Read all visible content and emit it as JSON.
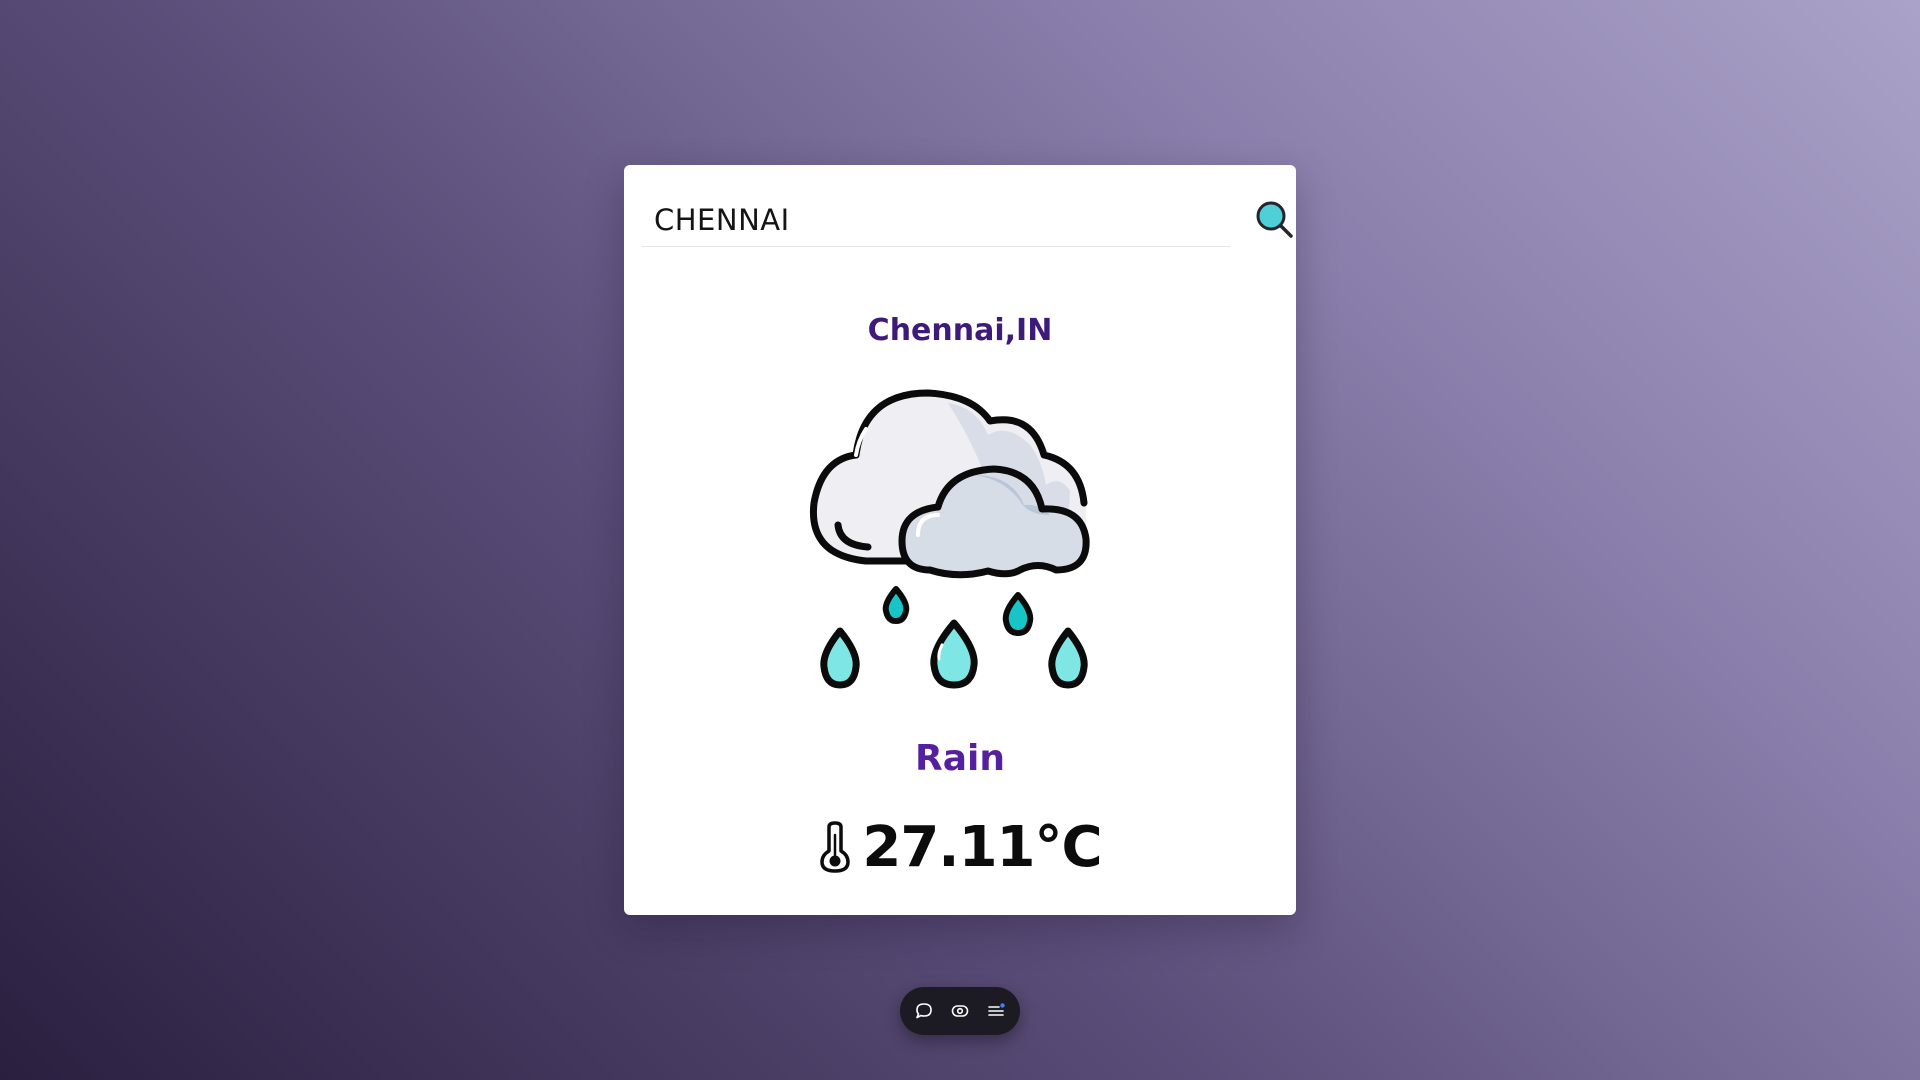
{
  "search": {
    "value": "CHENNAI",
    "placeholder": ""
  },
  "weather": {
    "location": "Chennai,IN",
    "icon": "cloud-rain-icon",
    "condition": "Rain",
    "temperature": "27.11°C"
  },
  "icons": {
    "search_button": "search-icon",
    "temperature": "thermometer-icon",
    "toolbar": [
      "comment-icon",
      "eye-icon",
      "menu-icon"
    ]
  },
  "colors": {
    "accent_primary": "#3e1a7a",
    "accent_condition": "#5520a0",
    "search_icon_fill": "#4fcfd8",
    "rain_drop": "#7fe6e6",
    "toolbar_bg": "#1c1a22",
    "notification_dot": "#3b82f6"
  }
}
